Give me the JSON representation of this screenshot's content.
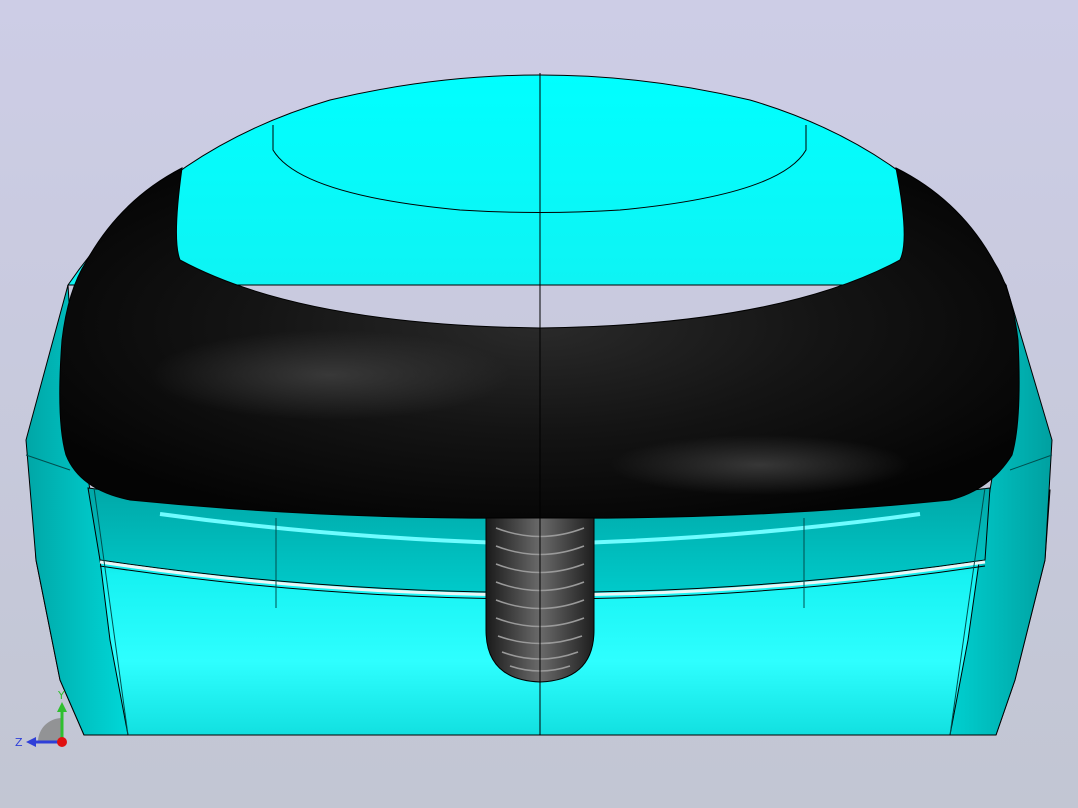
{
  "viewport": {
    "background_top": "#cdcde6",
    "background_bottom": "#c2c6d3"
  },
  "model": {
    "body_color": "#00ffff",
    "cushion_color": "#0a0a0a",
    "knob_color": "#3a3a3a",
    "edge_color": "#000000"
  },
  "triad": {
    "y_label": "Y",
    "z_label": "Z",
    "y_color": "#2fbf2f",
    "z_color": "#2f3fd8",
    "x_color": "#e01010"
  }
}
